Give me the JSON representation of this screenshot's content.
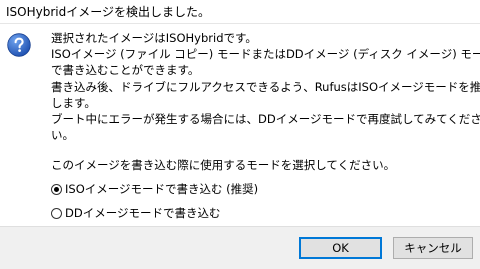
{
  "window": {
    "title": "ISOHybridイメージを検出しました。"
  },
  "dialog": {
    "icon": "question-icon",
    "message_lines": [
      "選択されたイメージはISOHybridです。",
      "ISOイメージ (ファイル コピー) モードまたはDDイメージ (ディスク イメージ) モード",
      "で書き込むことができます。",
      "書き込み後、ドライブにフルアクセスできるよう、RufusはISOイメージモードを推奨",
      "します。",
      "ブート中にエラーが発生する場合には、DDイメージモードで再度試してみてくださ",
      "い。"
    ],
    "prompt": "このイメージを書き込む際に使用するモードを選択してください。",
    "options": [
      {
        "label": "ISOイメージモードで書き込む (推奨)",
        "selected": true
      },
      {
        "label": "DDイメージモードで書き込む",
        "selected": false
      }
    ]
  },
  "buttons": {
    "ok": "OK",
    "cancel": "キャンセル"
  },
  "colors": {
    "accent": "#0078d7",
    "icon_blue": "#2a67c6",
    "footer_bg": "#f0f0f0"
  }
}
